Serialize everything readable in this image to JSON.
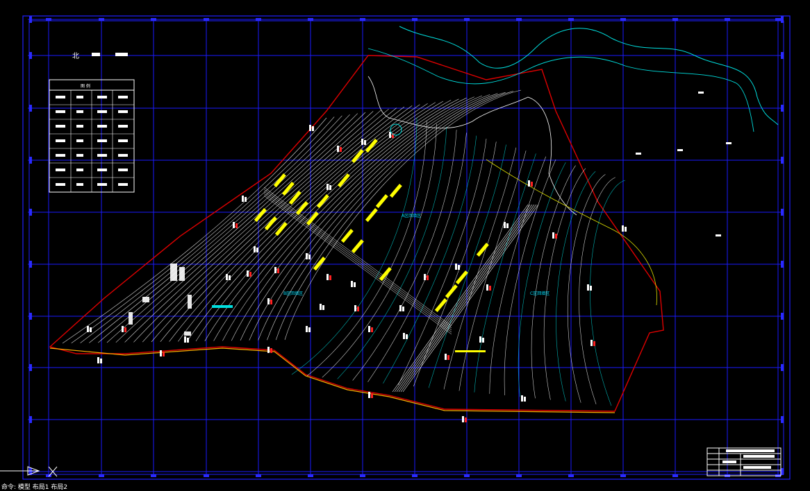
{
  "drawing": {
    "north_label": "北",
    "legend_title": "图    例",
    "zone_labels": [
      "A区回填区",
      "B区回填区",
      "C区回填区"
    ]
  },
  "status_bar": {
    "text": "命令: 模型 布局1 布局2"
  },
  "colors": {
    "background": "#000000",
    "grid": "#1a1aff",
    "contour_white": "#ffffff",
    "contour_cyan": "#00e0e0",
    "boundary_red": "#e00000",
    "highlight_yellow": "#ffff00"
  }
}
